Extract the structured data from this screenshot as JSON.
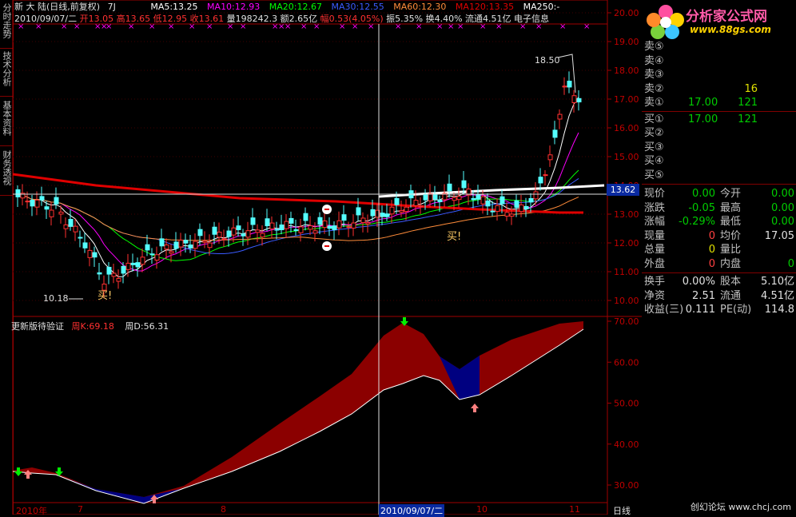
{
  "side_tabs": [
    {
      "label": "分时走势"
    },
    {
      "label": "技术分析"
    },
    {
      "label": "基本资料"
    },
    {
      "label": "财务透视"
    }
  ],
  "header": {
    "stock": "新 大 陆(日线,前复权)",
    "period": "7J",
    "ma5": "MA5:13.25",
    "ma10": "MA10:12.93",
    "ma20": "MA20:12.67",
    "ma30": "MA30:12.55",
    "ma60": "MA60:12.30",
    "ma120": "MA120:13.35",
    "ma250": "MA250:-",
    "line2_date": "2010/09/07/二",
    "open": "开13.05",
    "high": "高13.65",
    "low": "低12.95",
    "close": "收13.61",
    "volume": "量198242.3",
    "amount": "额2.65亿",
    "change": "幅0.53(4.05%)",
    "amplitude": "振5.35%",
    "turnover": "换4.40%",
    "float": "流通4.51亿",
    "sector": "电子信息"
  },
  "indicator": {
    "name": "更新版待验证",
    "k_label": "周K:69.18",
    "d_label": "周D:56.31"
  },
  "price_axis": [
    "20.00",
    "19.00",
    "18.00",
    "17.00",
    "16.00",
    "15.00",
    "14.00",
    "13.00",
    "12.00",
    "11.00",
    "10.00"
  ],
  "crosshair_price": "13.62",
  "ind_axis": [
    "70.00",
    "60.00",
    "50.00",
    "40.00",
    "30.00"
  ],
  "annotations": {
    "high_mark": "18.50",
    "low_mark": "10.18",
    "buy1": "买!",
    "buy2": "买!"
  },
  "date_axis": [
    "2010年",
    "7",
    "8",
    "2010/09/07/二",
    "10",
    "11"
  ],
  "right_bottom": "日线",
  "logo": {
    "title": "分析家公式网",
    "url": "www.88gs.com"
  },
  "order_book": {
    "sells": [
      {
        "label": "卖⑤",
        "price": "",
        "vol": ""
      },
      {
        "label": "卖④",
        "price": "",
        "vol": ""
      },
      {
        "label": "卖③",
        "price": "",
        "vol": ""
      },
      {
        "label": "卖②",
        "price": "",
        "vol": "16"
      },
      {
        "label": "卖①",
        "price": "17.00",
        "vol": "121"
      }
    ],
    "buys": [
      {
        "label": "买①",
        "price": "17.00",
        "vol": "121"
      },
      {
        "label": "买②",
        "price": "",
        "vol": ""
      },
      {
        "label": "买③",
        "price": "",
        "vol": ""
      },
      {
        "label": "买④",
        "price": "",
        "vol": ""
      },
      {
        "label": "买⑤",
        "price": "",
        "vol": ""
      }
    ]
  },
  "quote_stats": [
    {
      "l1": "现价",
      "v1": "0.00",
      "c1": "#00cc00",
      "l2": "今开",
      "v2": "0.00",
      "c2": "#00cc00"
    },
    {
      "l1": "涨跌",
      "v1": "-0.05",
      "c1": "#00cc00",
      "l2": "最高",
      "v2": "0.00",
      "c2": "#00cc00"
    },
    {
      "l1": "涨幅",
      "v1": "-0.29%",
      "c1": "#00cc00",
      "l2": "最低",
      "v2": "0.00",
      "c2": "#00cc00"
    },
    {
      "l1": "现量",
      "v1": "0",
      "c1": "#ff4040",
      "l2": "均价",
      "v2": "17.05",
      "c2": "#e0e0e0"
    },
    {
      "l1": "总量",
      "v1": "0",
      "c1": "#e0e000",
      "l2": "量比",
      "v2": "",
      "c2": "#e0e0e0"
    },
    {
      "l1": "外盘",
      "v1": "0",
      "c1": "#ff4040",
      "l2": "内盘",
      "v2": "0",
      "c2": "#00cc00"
    }
  ],
  "fund_stats": [
    {
      "l1": "换手",
      "v1": "0.00%",
      "l2": "股本",
      "v2": "5.10亿"
    },
    {
      "l1": "净资",
      "v1": "2.51",
      "l2": "流通",
      "v2": "4.51亿"
    },
    {
      "l1": "收益(三)",
      "v1": "0.111",
      "l2": "PE(动)",
      "v2": "114.8"
    }
  ],
  "watermark": "创幻论坛 www.chcj.com",
  "colors": {
    "up": "#ff3030",
    "down": "#54ffff",
    "ma5": "#ffffff",
    "ma10": "#ff00ff",
    "ma20": "#00ff00",
    "ma30": "#3a5bff",
    "ma60": "#ff8c3a",
    "ma120": "#e00000",
    "ma250": "#ffffff",
    "frame": "#a00000",
    "ribbon_up": "#8b0000",
    "ribbon_down": "#000080"
  }
}
